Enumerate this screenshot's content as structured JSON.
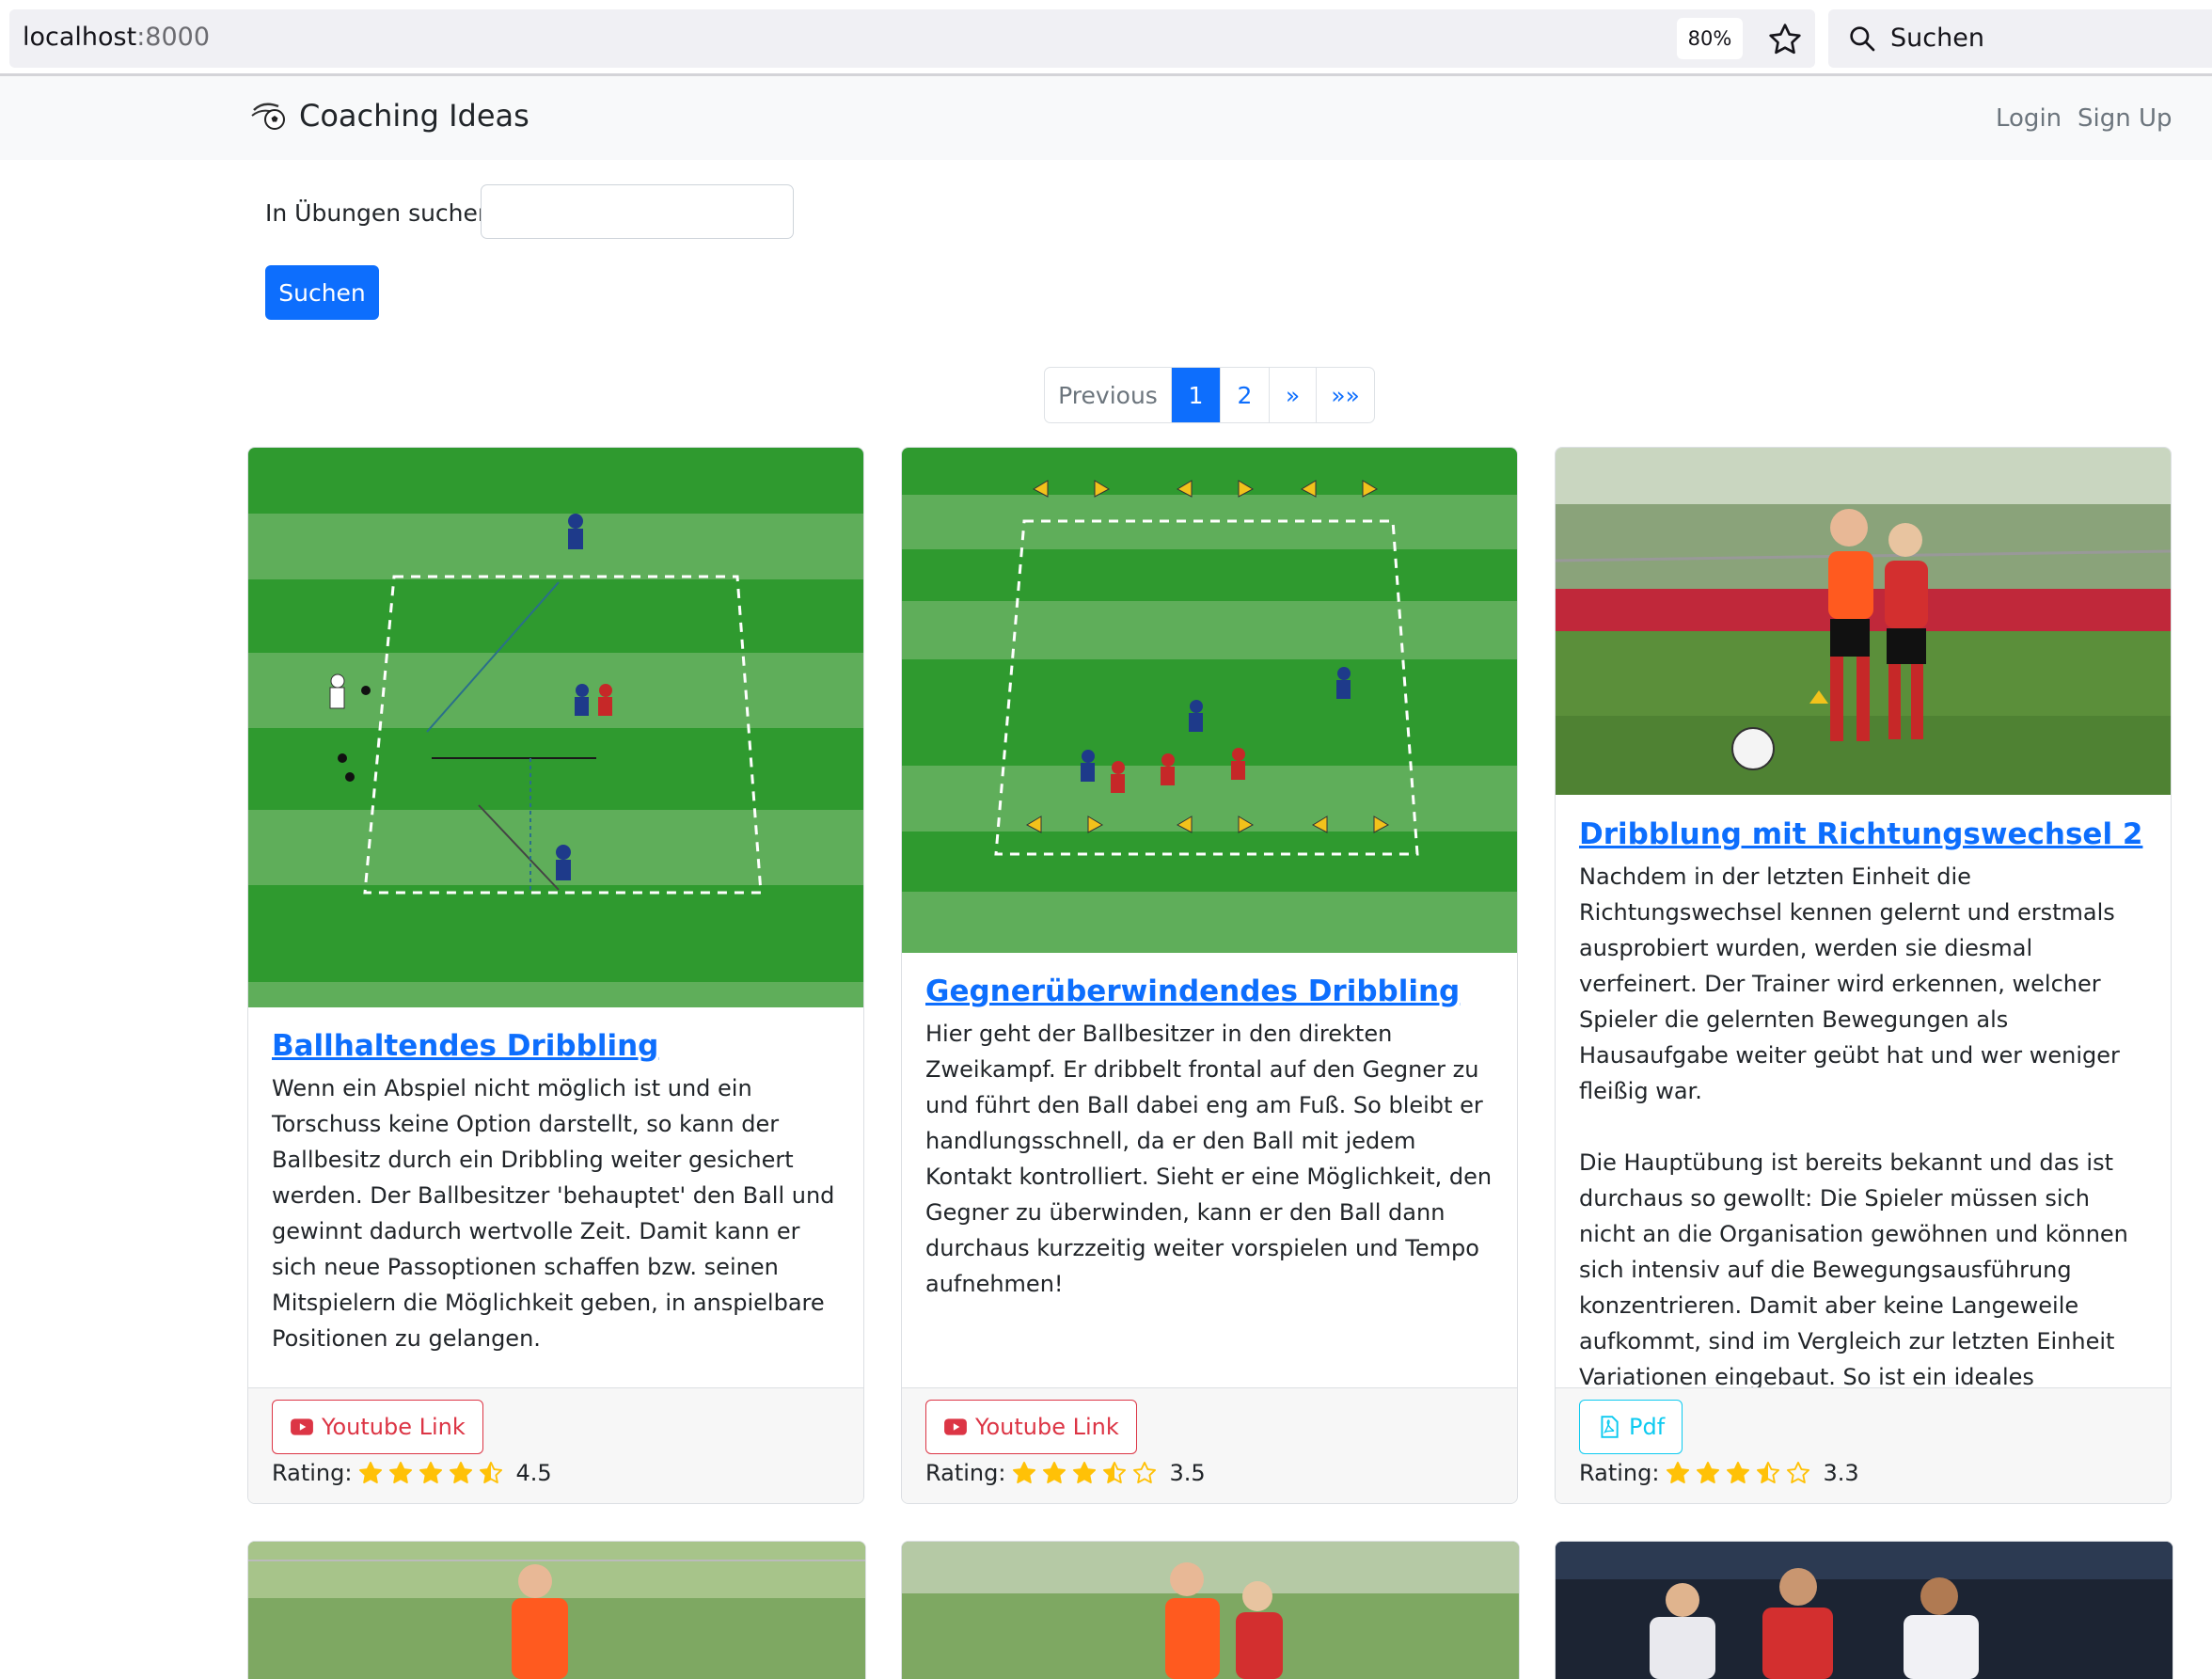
{
  "browser": {
    "url_host": "localhost",
    "url_port": ":8000",
    "zoom": "80%",
    "search_placeholder": "Suchen"
  },
  "navbar": {
    "brand": "Coaching Ideas",
    "login": "Login",
    "signup": "Sign Up"
  },
  "search": {
    "label": "In Übungen suchen:",
    "value": "",
    "button": "Suchen"
  },
  "pagination": {
    "previous": "Previous",
    "pages": [
      "1",
      "2"
    ],
    "active_page": "1",
    "next": "»",
    "last": "»»"
  },
  "cards": [
    {
      "title": "Ballhaltendes Dribbling",
      "text": "Wenn ein Abspiel nicht möglich ist und ein Torschuss keine Option darstellt, so kann der Ballbesitz durch ein Dribbling weiter gesichert werden. Der Ballbesitzer 'behauptet' den Ball und gewinnt dadurch wertvolle Zeit. Damit kann er sich neue Passoptionen schaffen bzw. seinen Mitspielern die Möglichkeit geben, in anspielbare Positionen zu gelangen.",
      "link_label": "Youtube Link",
      "link_type": "youtube",
      "rating_label": "Rating:",
      "rating": 4.5,
      "rating_text": "4.5"
    },
    {
      "title": "Gegnerüberwindendes Dribbling",
      "text": "Hier geht der Ballbesitzer in den direkten Zweikampf. Er dribbelt frontal auf den Gegner zu und führt den Ball dabei eng am Fuß. So bleibt er handlungsschnell, da er den Ball mit jedem Kontakt kontrolliert. Sieht er eine Möglichkeit, den Gegner zu überwinden, kann er den Ball dann durchaus kurzzeitig weiter vorspielen und Tempo aufnehmen!",
      "link_label": "Youtube Link",
      "link_type": "youtube",
      "rating_label": "Rating:",
      "rating": 3.5,
      "rating_text": "3.5"
    },
    {
      "title": "Dribblung mit Richtungswechsel 2",
      "text": "Nachdem in der letzten Einheit die Richtungswechsel kennen gelernt und erstmals ausprobiert wurden, werden sie diesmal verfeinert. Der Trainer wird erkennen, welcher Spieler die gelernten Bewegungen als Hausaufgabe weiter geübt hat und wer weniger fleißig war.\n\nDie Hauptübung ist bereits bekannt und das ist durchaus so gewollt: Die Spieler müssen sich nicht an die Organisation gewöhnen und können sich intensiv auf die Bewegungsausführung konzentrieren. Damit aber keine Langeweile aufkommt, sind im Vergleich zur letzten Einheit Variationen eingebaut. So ist ein ideales Verhältnis von Bekanntem ...",
      "link_label": "Pdf",
      "link_type": "pdf",
      "rating_label": "Rating:",
      "rating": 3.3,
      "rating_text": "3.3"
    }
  ],
  "colors": {
    "primary": "#0d6efd",
    "youtube": "#dc3545",
    "pdf": "#0dcaf0",
    "star": "#ffc107",
    "pitch_dark": "#2f9a2f",
    "pitch_light": "#5fae5a"
  },
  "icons": {
    "browser_star": "star-outline-icon",
    "browser_search": "magnifier-icon",
    "brand": "soccer-ball-icon",
    "youtube": "youtube-icon",
    "pdf": "file-pdf-icon",
    "rating": "star-icon"
  }
}
